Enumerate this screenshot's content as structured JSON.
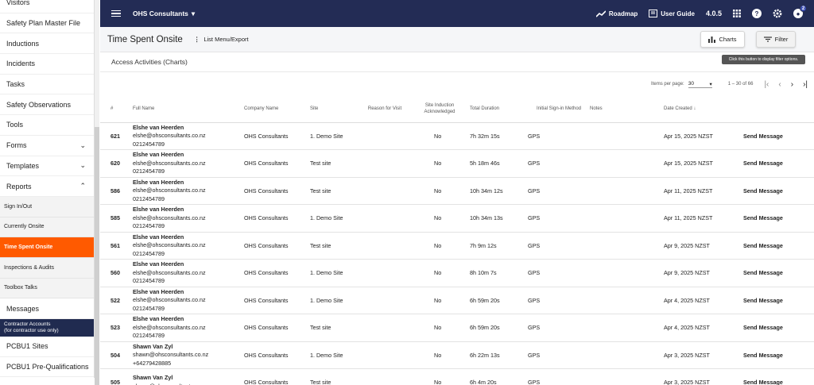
{
  "sidebar": {
    "items": [
      {
        "label": "Visitors",
        "type": "item"
      },
      {
        "label": "Safety Plan Master File",
        "type": "item"
      },
      {
        "label": "Inductions",
        "type": "item"
      },
      {
        "label": "Incidents",
        "type": "item"
      },
      {
        "label": "Tasks",
        "type": "item"
      },
      {
        "label": "Safety Observations",
        "type": "item"
      },
      {
        "label": "Tools",
        "type": "item"
      },
      {
        "label": "Forms",
        "type": "item",
        "chevron": "⌄"
      },
      {
        "label": "Templates",
        "type": "item",
        "chevron": "⌄"
      },
      {
        "label": "Reports",
        "type": "item",
        "chevron": "⌃"
      },
      {
        "label": "Sign In/Out",
        "type": "sub"
      },
      {
        "label": "Currently Onsite",
        "type": "sub"
      },
      {
        "label": "Time Spent Onsite",
        "type": "sub",
        "active": true
      },
      {
        "label": "Inspections & Audits",
        "type": "sub"
      },
      {
        "label": "Toolbox Talks",
        "type": "sub"
      },
      {
        "label": "Messages",
        "type": "item"
      }
    ],
    "contractor_label_1": "Contractor Accounts",
    "contractor_label_2": "(for contractor use only)",
    "bottom_items": [
      "PCBU1 Sites",
      "PCBU1 Pre-Qualifications"
    ]
  },
  "topbar": {
    "org": "OHS Consultants",
    "roadmap": "Roadmap",
    "user_guide": "User Guide",
    "version": "4.0.5",
    "notif_count": "2"
  },
  "page": {
    "title": "Time Spent Onsite",
    "menu_export": "List Menu/Export",
    "charts_btn": "Charts",
    "filter_btn": "Filter",
    "tooltip": "Click this button to display filter options.",
    "section": "Access Activities (Charts)"
  },
  "pager": {
    "items_label": "Items per page:",
    "per_page": "30",
    "range": "1 – 30 of 66"
  },
  "table": {
    "headers": [
      "#",
      "Full Name",
      "Company Name",
      "Site",
      "Reason for Visit",
      "Site Induction Acknowledged",
      "Total Duration",
      "Initial Sign-in Method",
      "Notes",
      "Date Created ↓",
      ""
    ],
    "rows": [
      {
        "num": "621",
        "name": "Elshe van Heerden",
        "email": "elshe@ohsconsultants.co.nz",
        "phone": "0212454789",
        "company": "OHS Consultants",
        "site": "1. Demo Site",
        "reason": "",
        "ack": "No",
        "duration": "7h 32m 15s",
        "method": "GPS",
        "notes": "",
        "date": "Apr 15, 2025 NZST",
        "action": "Send Message"
      },
      {
        "num": "620",
        "name": "Elshe van Heerden",
        "email": "elshe@ohsconsultants.co.nz",
        "phone": "0212454789",
        "company": "OHS Consultants",
        "site": "Test site",
        "reason": "",
        "ack": "No",
        "duration": "5h 18m 46s",
        "method": "GPS",
        "notes": "",
        "date": "Apr 15, 2025 NZST",
        "action": "Send Message"
      },
      {
        "num": "586",
        "name": "Elshe van Heerden",
        "email": "elshe@ohsconsultants.co.nz",
        "phone": "0212454789",
        "company": "OHS Consultants",
        "site": "Test site",
        "reason": "",
        "ack": "No",
        "duration": "10h 34m 12s",
        "method": "GPS",
        "notes": "",
        "date": "Apr 11, 2025 NZST",
        "action": "Send Message"
      },
      {
        "num": "585",
        "name": "Elshe van Heerden",
        "email": "elshe@ohsconsultants.co.nz",
        "phone": "0212454789",
        "company": "OHS Consultants",
        "site": "1. Demo Site",
        "reason": "",
        "ack": "No",
        "duration": "10h 34m 13s",
        "method": "GPS",
        "notes": "",
        "date": "Apr 11, 2025 NZST",
        "action": "Send Message"
      },
      {
        "num": "561",
        "name": "Elshe van Heerden",
        "email": "elshe@ohsconsultants.co.nz",
        "phone": "0212454789",
        "company": "OHS Consultants",
        "site": "Test site",
        "reason": "",
        "ack": "No",
        "duration": "7h 9m 12s",
        "method": "GPS",
        "notes": "",
        "date": "Apr 9, 2025 NZST",
        "action": "Send Message"
      },
      {
        "num": "560",
        "name": "Elshe van Heerden",
        "email": "elshe@ohsconsultants.co.nz",
        "phone": "0212454789",
        "company": "OHS Consultants",
        "site": "1. Demo Site",
        "reason": "",
        "ack": "No",
        "duration": "8h 10m 7s",
        "method": "GPS",
        "notes": "",
        "date": "Apr 9, 2025 NZST",
        "action": "Send Message"
      },
      {
        "num": "522",
        "name": "Elshe van Heerden",
        "email": "elshe@ohsconsultants.co.nz",
        "phone": "0212454789",
        "company": "OHS Consultants",
        "site": "1. Demo Site",
        "reason": "",
        "ack": "No",
        "duration": "6h 59m 20s",
        "method": "GPS",
        "notes": "",
        "date": "Apr 4, 2025 NZST",
        "action": "Send Message"
      },
      {
        "num": "523",
        "name": "Elshe van Heerden",
        "email": "elshe@ohsconsultants.co.nz",
        "phone": "0212454789",
        "company": "OHS Consultants",
        "site": "Test site",
        "reason": "",
        "ack": "No",
        "duration": "6h 59m 20s",
        "method": "GPS",
        "notes": "",
        "date": "Apr 4, 2025 NZST",
        "action": "Send Message"
      },
      {
        "num": "504",
        "name": "Shawn Van Zyl",
        "email": "shawn@ohsconsultants.co.nz",
        "phone": "+64279428885",
        "company": "OHS Consultants",
        "site": "1. Demo Site",
        "reason": "",
        "ack": "No",
        "duration": "6h 22m 13s",
        "method": "GPS",
        "notes": "",
        "date": "Apr 3, 2025 NZST",
        "action": "Send Message"
      },
      {
        "num": "505",
        "name": "Shawn Van Zyl",
        "email": "shawn@ohsconsultants.co.nz",
        "phone": "",
        "company": "OHS Consultants",
        "site": "Test site",
        "reason": "",
        "ack": "No",
        "duration": "6h 4m 20s",
        "method": "GPS",
        "notes": "",
        "date": "Apr 3, 2025 NZST",
        "action": "Send Message"
      }
    ]
  },
  "colors": {
    "topbar": "#232c55",
    "active": "#ff5a00",
    "contractor": "#202b50"
  }
}
